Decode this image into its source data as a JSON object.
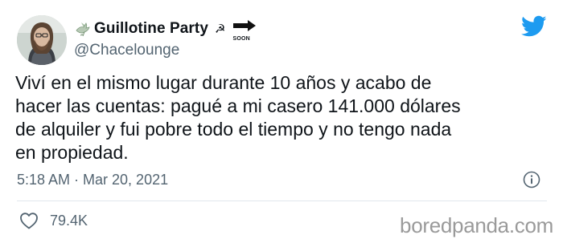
{
  "user": {
    "display_name": "Guillotine Party",
    "handle": "@Chacelounge",
    "avatar": "avatar",
    "name_icons": [
      "dove-icon",
      "hammer-sickle-icon",
      "soon-arrow-icon"
    ],
    "soon_label": "SOON",
    "sickle_glyph": "☭"
  },
  "tweet": {
    "text": "Viví en el mismo lugar durante 10 años y acabo de\nhacer las cuentas: pagué a mi casero 141.000 dólares\nde alquiler y fui pobre todo el tiempo y no tengo nada\nen propiedad.",
    "timestamp": "5:18 AM · Mar 20, 2021"
  },
  "actions": {
    "like_icon": "heart-icon",
    "like_count": "79.4K",
    "info_icon": "info-icon"
  },
  "brand": {
    "twitter_icon": "twitter-bird-icon",
    "twitter_color": "#1d9bf0",
    "watermark": "boredpanda.com"
  },
  "colors": {
    "text": "#0f1419",
    "secondary": "#536471",
    "divider": "#e1e8ed"
  }
}
